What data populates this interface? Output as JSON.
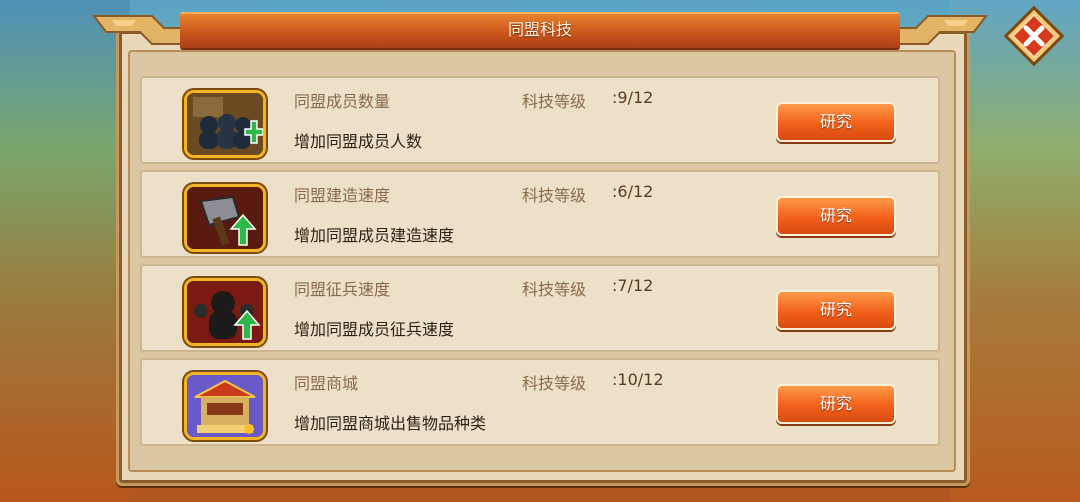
{
  "title": "同盟科技",
  "level_label": "科技等级",
  "research_label": "研究",
  "rows": [
    {
      "name": "同盟成员数量",
      "level": ":9/12",
      "desc": "增加同盟成员人数",
      "icon": "member-count-icon"
    },
    {
      "name": "同盟建造速度",
      "level": ":6/12",
      "desc": "增加同盟成员建造速度",
      "icon": "build-speed-icon"
    },
    {
      "name": "同盟征兵速度",
      "level": ":7/12",
      "desc": "增加同盟成员征兵速度",
      "icon": "recruit-speed-icon"
    },
    {
      "name": "同盟商城",
      "level": ":10/12",
      "desc": "增加同盟商城出售物品种类",
      "icon": "shop-icon"
    }
  ],
  "colors": {
    "accent": "#f2601a",
    "frame": "#c79a5c",
    "title_bar": "#c8541b"
  }
}
